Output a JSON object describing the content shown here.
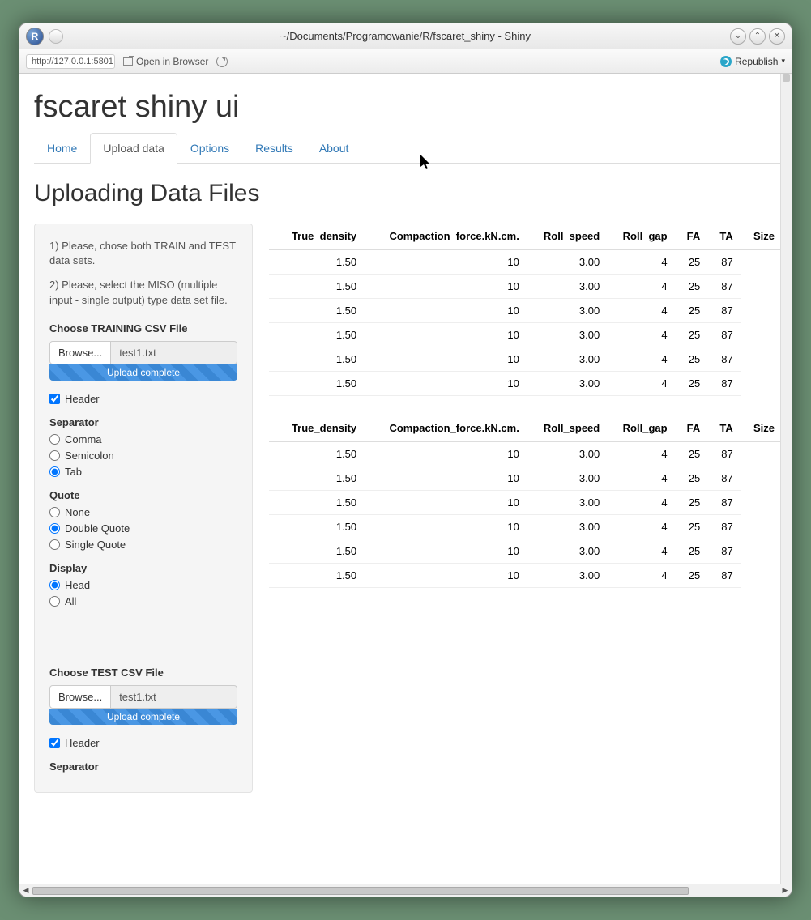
{
  "window": {
    "title": "~/Documents/Programowanie/R/fscaret_shiny - Shiny",
    "url": "http://127.0.0.1:5801",
    "open_in_browser": "Open in Browser",
    "republish": "Republish"
  },
  "app": {
    "title": "fscaret shiny ui",
    "tabs": [
      "Home",
      "Upload data",
      "Options",
      "Results",
      "About"
    ],
    "active_tab": 1,
    "section_heading": "Uploading Data Files"
  },
  "sidebar": {
    "intro1": "1) Please, chose both TRAIN and TEST data sets.",
    "intro2": "2) Please, select the MISO (multiple input - single output) type data set file.",
    "train_label": "Choose TRAINING CSV File",
    "test_label": "Choose TEST CSV File",
    "browse": "Browse...",
    "filename": "test1.txt",
    "upload_status": "Upload complete",
    "header_label": "Header",
    "header_checked": true,
    "separator": {
      "title": "Separator",
      "options": [
        "Comma",
        "Semicolon",
        "Tab"
      ],
      "selected": "Tab"
    },
    "quote": {
      "title": "Quote",
      "options": [
        "None",
        "Double Quote",
        "Single Quote"
      ],
      "selected": "Double Quote"
    },
    "display": {
      "title": "Display",
      "options": [
        "Head",
        "All"
      ],
      "selected": "Head"
    },
    "separator2_title": "Separator"
  },
  "table": {
    "headers": [
      "True_density",
      "Compaction_force.kN.cm.",
      "Roll_speed",
      "Roll_gap",
      "FA",
      "TA",
      "Size"
    ],
    "rows": [
      [
        "1.50",
        "10",
        "3.00",
        "4",
        "25",
        "87"
      ],
      [
        "1.50",
        "10",
        "3.00",
        "4",
        "25",
        "87"
      ],
      [
        "1.50",
        "10",
        "3.00",
        "4",
        "25",
        "87"
      ],
      [
        "1.50",
        "10",
        "3.00",
        "4",
        "25",
        "87"
      ],
      [
        "1.50",
        "10",
        "3.00",
        "4",
        "25",
        "87"
      ],
      [
        "1.50",
        "10",
        "3.00",
        "4",
        "25",
        "87"
      ]
    ]
  }
}
